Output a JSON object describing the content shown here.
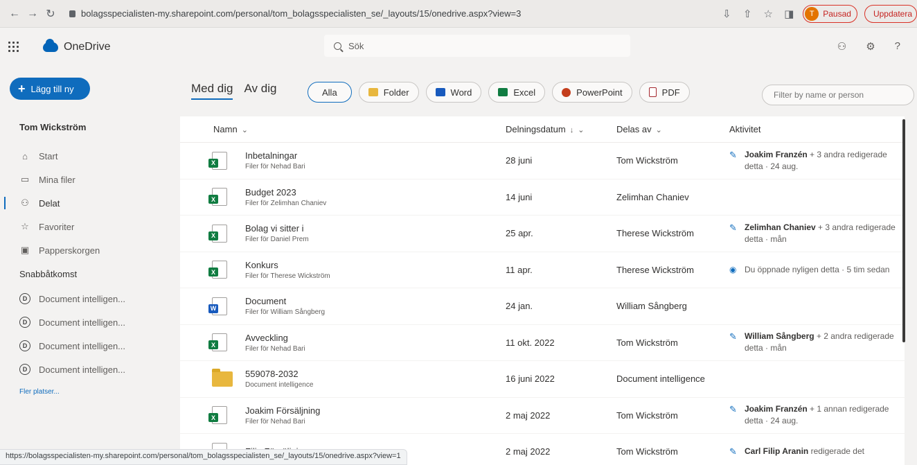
{
  "browser": {
    "url": "bolagsspecialisten-my.sharepoint.com/personal/tom_bolagsspecialisten_se/_layouts/15/onedrive.aspx?view=3",
    "profile_initial": "T",
    "profile_status": "Pausad",
    "update_label": "Uppdatera"
  },
  "header": {
    "app_name": "OneDrive",
    "search_placeholder": "Sök"
  },
  "sidebar": {
    "new_button": "Lägg till ny",
    "user_name": "Tom Wickström",
    "nav": [
      {
        "label": "Start",
        "icon": "home-icon"
      },
      {
        "label": "Mina filer",
        "icon": "folder-icon"
      },
      {
        "label": "Delat",
        "icon": "people-icon"
      },
      {
        "label": "Favoriter",
        "icon": "star-icon"
      },
      {
        "label": "Papperskorgen",
        "icon": "trash-icon"
      }
    ],
    "quick_access_title": "Snabbåtkomst",
    "quick_access": [
      {
        "label": "Document intelligen..."
      },
      {
        "label": "Document intelligen..."
      },
      {
        "label": "Document intelligen..."
      },
      {
        "label": "Document intelligen..."
      }
    ],
    "more_places": "Fler platser..."
  },
  "main": {
    "tabs": [
      {
        "label": "Med dig"
      },
      {
        "label": "Av dig"
      }
    ],
    "filters": [
      {
        "label": "Alla"
      },
      {
        "label": "Folder"
      },
      {
        "label": "Word"
      },
      {
        "label": "Excel"
      },
      {
        "label": "PowerPoint"
      },
      {
        "label": "PDF"
      }
    ],
    "filter_placeholder": "Filter by name or person",
    "columns": {
      "name": "Namn",
      "date": "Delningsdatum",
      "by": "Delas av",
      "activity": "Aktivitet"
    },
    "rows": [
      {
        "name": "Inbetalningar",
        "sub": "Filer för Nehad Bari",
        "date": "28 juni",
        "by": "Tom Wickström",
        "act_bold": "Joakim Franzén",
        "act_rest": " + 3 andra redigerade detta · 24 aug."
      },
      {
        "name": "Budget 2023",
        "sub": "Filer för Zelimhan Chaniev",
        "date": "14 juni",
        "by": "Zelimhan Chaniev",
        "act_bold": "",
        "act_rest": ""
      },
      {
        "name": "Bolag vi sitter i",
        "sub": "Filer för Daniel Prem",
        "date": "25 apr.",
        "by": "Therese Wickström",
        "act_bold": "Zelimhan Chaniev",
        "act_rest": " + 3 andra redigerade detta · mån"
      },
      {
        "name": "Konkurs",
        "sub": "Filer för Therese Wickström",
        "date": "11 apr.",
        "by": "Therese Wickström",
        "act_bold": "",
        "act_rest": "Du öppnade nyligen detta · 5 tim sedan"
      },
      {
        "name": "Document",
        "sub": "Filer för William Sångberg",
        "date": "24 jan.",
        "by": "William Sångberg",
        "act_bold": "",
        "act_rest": ""
      },
      {
        "name": "Avveckling",
        "sub": "Filer för Nehad Bari",
        "date": "11 okt. 2022",
        "by": "Tom Wickström",
        "act_bold": "William Sångberg",
        "act_rest": " + 2 andra redigerade detta · mån"
      },
      {
        "name": "559078-2032",
        "sub": "Document intelligence",
        "date": "16 juni 2022",
        "by": "Document intelligence",
        "act_bold": "",
        "act_rest": ""
      },
      {
        "name": "Joakim Försäljning",
        "sub": "Filer för Nehad Bari",
        "date": "2 maj 2022",
        "by": "Tom Wickström",
        "act_bold": "Joakim Franzén",
        "act_rest": " + 1 annan redigerade detta · 24 aug."
      },
      {
        "name": "Filip Försäljning",
        "sub": "",
        "date": "2 maj 2022",
        "by": "Tom Wickström",
        "act_bold": "Carl Filip Aranin",
        "act_rest": " redigerade det"
      }
    ]
  },
  "status_url": "https://bolagsspecialisten-my.sharepoint.com/personal/tom_bolagsspecialisten_se/_layouts/15/onedrive.aspx?view=1"
}
